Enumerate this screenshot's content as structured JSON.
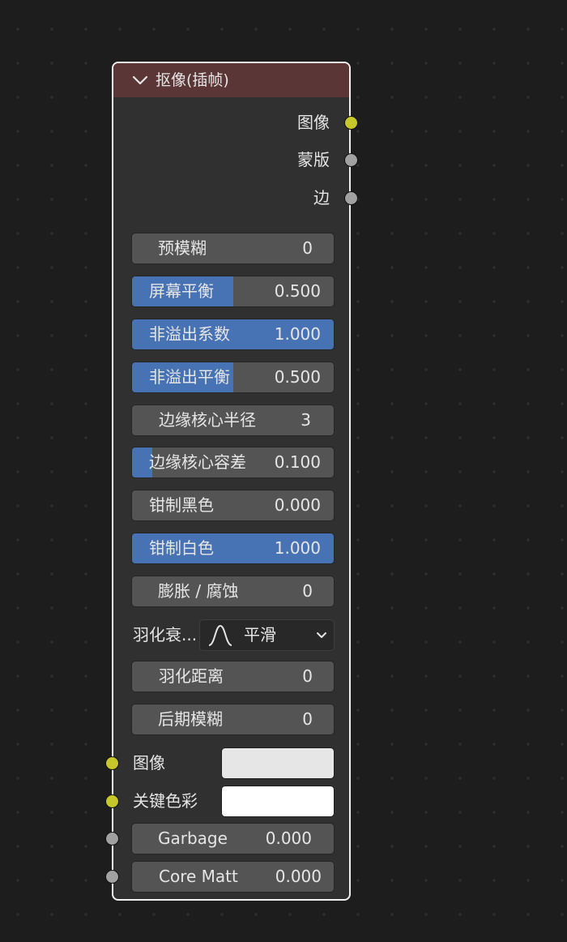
{
  "node": {
    "title": "抠像(插帧)",
    "header_color": "#5a3636",
    "outputs": [
      {
        "label": "图像",
        "socket_color": "#c7c72b"
      },
      {
        "label": "蒙版",
        "socket_color": "#a1a1a1"
      },
      {
        "label": "边",
        "socket_color": "#a1a1a1"
      }
    ],
    "fields": [
      {
        "label": "预模糊",
        "value": "0"
      },
      {
        "label": "屏幕平衡",
        "value": "0.500",
        "fill": 0.5
      },
      {
        "label": "非溢出系数",
        "value": "1.000",
        "fill": 1.0
      },
      {
        "label": "非溢出平衡",
        "value": "0.500",
        "fill": 0.5
      },
      {
        "label": "边缘核心半径",
        "value": "3"
      },
      {
        "label": "边缘核心容差",
        "value": "0.100",
        "fill": 0.1
      },
      {
        "label": "钳制黑色",
        "value": "0.000",
        "fill": 0.0
      },
      {
        "label": "钳制白色",
        "value": "1.000",
        "fill": 1.0
      },
      {
        "label": "膨胀 / 腐蚀",
        "value": "0"
      }
    ],
    "falloff": {
      "label": "羽化衰...",
      "icon": "smooth-falloff-icon",
      "value": "平滑"
    },
    "fields2": [
      {
        "label": "羽化距离",
        "value": "0"
      },
      {
        "label": "后期模糊",
        "value": "0"
      }
    ],
    "inputs": [
      {
        "label": "图像",
        "socket_color": "#c7c72b",
        "swatch_color": "#e6e6e6"
      },
      {
        "label": "关键色彩",
        "socket_color": "#c7c72b",
        "swatch_color": "#ffffff"
      }
    ],
    "input_fields": [
      {
        "label": "Garbage",
        "value": "0.000",
        "socket_color": "#a1a1a1"
      },
      {
        "label": "Core Matt",
        "value": "0.000",
        "socket_color": "#a1a1a1"
      }
    ],
    "accent_color": "#4772b3"
  }
}
